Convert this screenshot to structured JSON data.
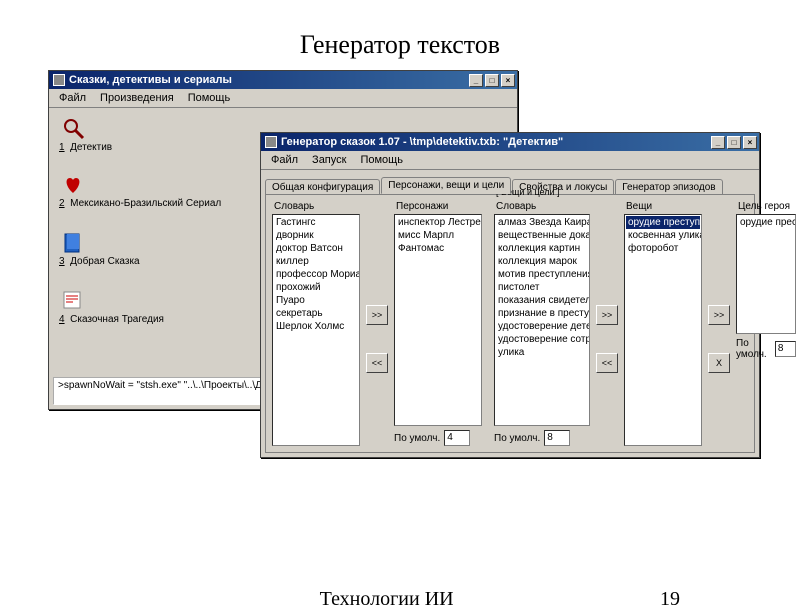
{
  "slide": {
    "title": "Генератор текстов",
    "footer_text": "Технологии ИИ",
    "page_number": "19"
  },
  "window1": {
    "title": "Сказки, детективы и сериалы",
    "menu": {
      "file": "Файл",
      "works": "Произведения",
      "help": "Помощь"
    },
    "win_controls": {
      "min": "_",
      "max": "□",
      "close": "×"
    },
    "shortcuts": {
      "s1": {
        "num": "1",
        "label": "Детектив"
      },
      "s2": {
        "num": "2",
        "label": "Мексикано-Бразильский Сериал"
      },
      "s3": {
        "num": "3",
        "label": "Добрая Сказка"
      },
      "s4": {
        "num": "4",
        "label": "Сказочная Трагедия"
      }
    },
    "status": ">spawnNoWait = \"stsh.exe\" \"..\\..\\Проекты\\..\\Детектив.sр"
  },
  "window2": {
    "title": "Генератор сказок 1.07 - \\tmp\\detektiv.txb:  \"Детектив\"",
    "menu": {
      "file": "Файл",
      "run": "Запуск",
      "help": "Помощь"
    },
    "win_controls": {
      "min": "_",
      "max": "□",
      "close": "×"
    },
    "tabs": {
      "t1": "Общая конфигурация",
      "t2": "Персонажи, вещи и цели",
      "t3": "Свойства и локусы",
      "t4": "Генератор эпизодов"
    },
    "group_labels": {
      "dict1": "Словарь",
      "chars": "Персонажи",
      "dict2": "Словарь",
      "things": "Вещи",
      "things_goals": "[ Вещи и цели ]",
      "goal": "Цель героя"
    },
    "dict1_items": [
      "Гастингс",
      "дворник",
      "доктор Ватсон",
      "киллер",
      "профессор Мориарти",
      "прохожий",
      "Пуаро",
      "секретарь",
      "Шерлок Холмс"
    ],
    "chars_items": [
      "инспектор Лестрейд",
      "мисс Марпл",
      "Фантомас"
    ],
    "dict2_items": [
      "алмаз Звезда Каира",
      "вещественные доказа",
      "коллекция картин",
      "коллекция марок",
      "мотив преступления",
      "пистолет",
      "показания свидетеля",
      "признание в преступле",
      "удостоверение детект",
      "удостоверение сотрудн",
      "улика"
    ],
    "things_items": [
      "орудие преступления",
      "косвенная улика",
      "фоторобот"
    ],
    "goal_items": [
      "орудие преступления"
    ],
    "btns": {
      "fwd": ">>",
      "back": "<<",
      "x": "X"
    },
    "default_label": "По умолч.",
    "default1_value": "4",
    "default2_value": "8",
    "default3_value": "8"
  }
}
